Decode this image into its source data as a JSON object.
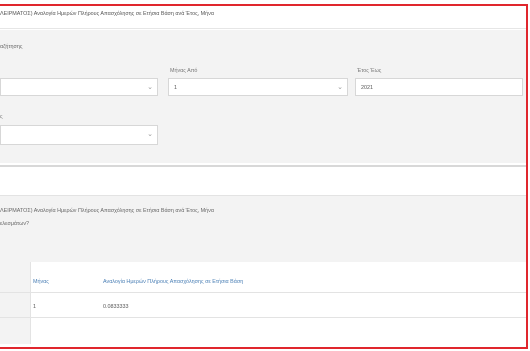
{
  "header": {
    "title": "ΛΕΙΡΜΑΤΟΣ) Αναλογία Ημερών Πλήρους Απασχόλησης σε Ετήσια Βάση ανά Έτος, Μήνα"
  },
  "filters": {
    "section_label": "αζήτησης",
    "select1": {
      "value": ""
    },
    "month_from": {
      "label": "Μήνας Από",
      "value": "1"
    },
    "year_to": {
      "label": "Έτος Έως",
      "value": "2021"
    },
    "row2_label": "ς",
    "select2": {
      "value": ""
    }
  },
  "results": {
    "title": "ΛΕΙΡΜΑΤΟΣ) Αναλογία Ημερών Πλήρους Απασχόλησης σε Ετήσια Βάση ανά Έτος, Μήνα",
    "subtitle": "ελεσμάτων?"
  },
  "table": {
    "columns": [
      "Μήνας",
      "Αναλογία Ημερών Πλήρους Απασχόλησης σε Ετήσια Βάση"
    ],
    "rows": [
      {
        "month": "1",
        "ratio": "0.0833333"
      }
    ]
  },
  "colors": {
    "border_accent": "#e0262d",
    "header_link": "#4a7fb5"
  }
}
